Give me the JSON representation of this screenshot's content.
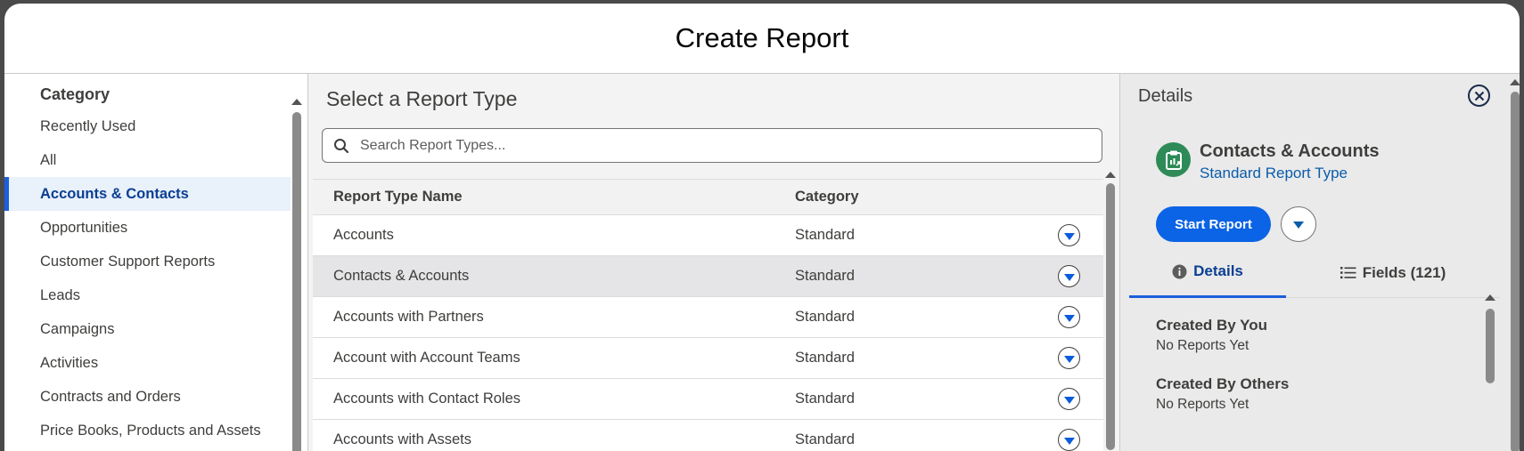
{
  "modal": {
    "title": "Create Report"
  },
  "sidebar": {
    "heading": "Category",
    "items": [
      {
        "label": "Recently Used",
        "active": false
      },
      {
        "label": "All",
        "active": false
      },
      {
        "label": "Accounts & Contacts",
        "active": true
      },
      {
        "label": "Opportunities",
        "active": false
      },
      {
        "label": "Customer Support Reports",
        "active": false
      },
      {
        "label": "Leads",
        "active": false
      },
      {
        "label": "Campaigns",
        "active": false
      },
      {
        "label": "Activities",
        "active": false
      },
      {
        "label": "Contracts and Orders",
        "active": false
      },
      {
        "label": "Price Books, Products and Assets",
        "active": false
      }
    ]
  },
  "main": {
    "title": "Select a Report Type",
    "search": {
      "placeholder": "Search Report Types...",
      "value": ""
    },
    "table": {
      "columns": [
        "Report Type Name",
        "Category"
      ],
      "rows": [
        {
          "name": "Accounts",
          "category": "Standard",
          "selected": false
        },
        {
          "name": "Contacts & Accounts",
          "category": "Standard",
          "selected": true
        },
        {
          "name": "Accounts with Partners",
          "category": "Standard",
          "selected": false
        },
        {
          "name": "Account with Account Teams",
          "category": "Standard",
          "selected": false
        },
        {
          "name": "Accounts with Contact Roles",
          "category": "Standard",
          "selected": false
        },
        {
          "name": "Accounts with Assets",
          "category": "Standard",
          "selected": false
        }
      ]
    }
  },
  "details": {
    "title": "Details",
    "report_type_name": "Contacts & Accounts",
    "report_type_kind": "Standard Report Type",
    "start_button": "Start Report",
    "tabs": [
      {
        "label": "Details",
        "icon": "info-icon",
        "active": true
      },
      {
        "label": "Fields (121)",
        "icon": "list-icon",
        "active": false
      }
    ],
    "sections": [
      {
        "heading": "Created By You",
        "value": "No Reports Yet"
      },
      {
        "heading": "Created By Others",
        "value": "No Reports Yet"
      }
    ]
  },
  "colors": {
    "accent": "#0b63e5",
    "active_text": "#0b3f93",
    "link": "#0b5cab",
    "report_icon_bg": "#2e8b57",
    "selected_row": "#e5e4e6"
  }
}
